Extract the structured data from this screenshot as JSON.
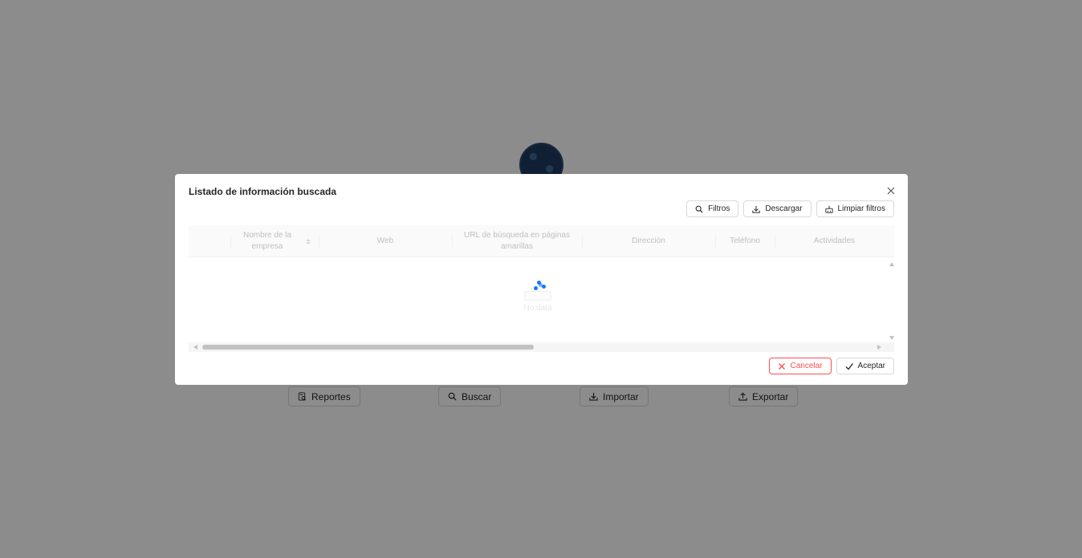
{
  "background_page": {
    "buttons": {
      "reportes": "Reportes",
      "buscar": "Buscar",
      "importar": "Importar",
      "exportar": "Exportar"
    }
  },
  "modal": {
    "title": "Listado de información buscada",
    "toolbar": {
      "filtros": "Filtros",
      "descargar": "Descargar",
      "limpiar_filtros": "Limpiar filtros"
    },
    "table": {
      "columns": [
        "",
        "Nombre de la empresa",
        "Web",
        "URL de búsqueda en páginas amarillas",
        "Dirección",
        "Teléfono",
        "Actividades"
      ],
      "sortable_column": "Nombre de la empresa",
      "rows": [],
      "empty_text": "No data",
      "loading": true
    },
    "footer": {
      "cancel": "Cancelar",
      "ok": "Aceptar"
    }
  },
  "colors": {
    "overlay": "#000000",
    "danger": "#ff4d4f",
    "primary": "#1677ff",
    "header_bg": "#fafafa",
    "logo": "#1e3a5f"
  }
}
